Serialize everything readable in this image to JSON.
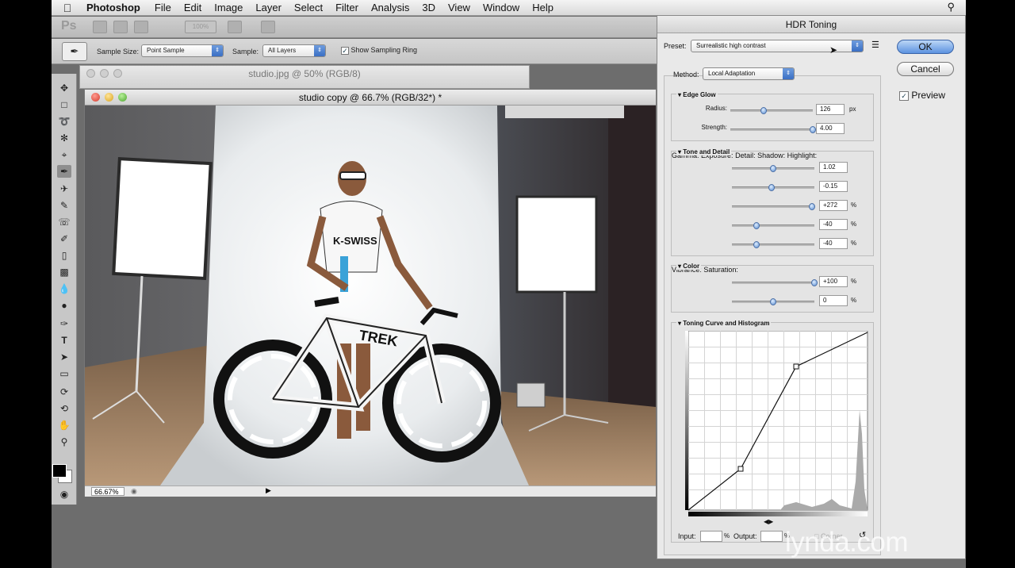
{
  "menubar": {
    "app_name": "Photoshop",
    "items": [
      "File",
      "Edit",
      "Image",
      "Layer",
      "Select",
      "Filter",
      "Analysis",
      "3D",
      "View",
      "Window",
      "Help"
    ]
  },
  "appbar": {
    "logo": "Ps",
    "zoom_value": "100%"
  },
  "options": {
    "sample_size_label": "Sample Size:",
    "sample_size_value": "Point Sample",
    "sample_label": "Sample:",
    "sample_value": "All Layers",
    "show_ring_label": "Show Sampling Ring"
  },
  "bg_document": {
    "title": "studio.jpg @ 50% (RGB/8)"
  },
  "document": {
    "title": "studio copy @ 66.7% (RGB/32*) *",
    "zoom": "66.67%"
  },
  "hdr": {
    "title": "HDR Toning",
    "preset_label": "Preset:",
    "preset_value": "Surrealistic high contrast",
    "ok_label": "OK",
    "cancel_label": "Cancel",
    "preview_label": "Preview",
    "method_label": "Method:",
    "method_value": "Local Adaptation",
    "edge_glow": {
      "title": "Edge Glow",
      "radius_label": "Radius:",
      "radius_value": "126",
      "radius_unit": "px",
      "radius_pos": 0.4,
      "strength_label": "Strength:",
      "strength_value": "4.00",
      "strength_pos": 1.0
    },
    "tone_detail": {
      "title": "Tone and Detail",
      "gamma_label": "Gamma:",
      "gamma_value": "1.02",
      "gamma_pos": 0.5,
      "exposure_label": "Exposure:",
      "exposure_value": "-0.15",
      "exposure_pos": 0.48,
      "detail_label": "Detail:",
      "detail_value": "+272",
      "detail_pos": 0.97,
      "shadow_label": "Shadow:",
      "shadow_value": "-40",
      "shadow_pos": 0.3,
      "highlight_label": "Highlight:",
      "highlight_value": "-40",
      "highlight_pos": 0.3,
      "percent": "%"
    },
    "color": {
      "title": "Color",
      "vibrance_label": "Vibrance:",
      "vibrance_value": "+100",
      "vibrance_pos": 1.0,
      "saturation_label": "Saturation:",
      "saturation_value": "0",
      "saturation_pos": 0.5,
      "percent": "%"
    },
    "curve": {
      "title": "Toning Curve and Histogram",
      "input_label": "Input:",
      "output_label": "Output:",
      "percent": "%",
      "corner_label": "Corner"
    }
  },
  "watermark": "lynda.com"
}
